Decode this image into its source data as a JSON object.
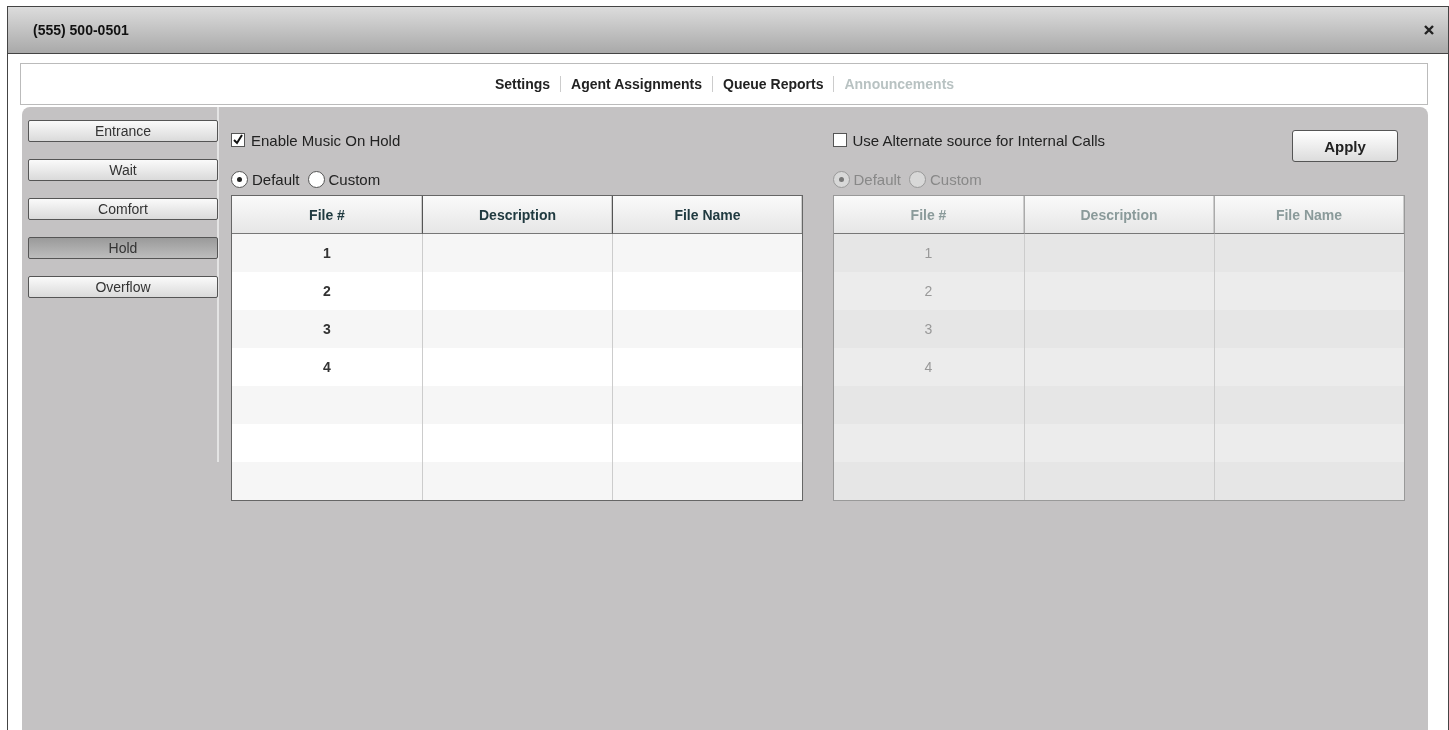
{
  "window": {
    "title": "(555) 500-0501"
  },
  "tabs": [
    {
      "label": "Settings",
      "selected": false
    },
    {
      "label": "Agent Assignments",
      "selected": false
    },
    {
      "label": "Queue Reports",
      "selected": false
    },
    {
      "label": "Announcements",
      "selected": true
    }
  ],
  "sidebar": {
    "items": [
      {
        "label": "Entrance",
        "selected": false
      },
      {
        "label": "Wait",
        "selected": false
      },
      {
        "label": "Comfort",
        "selected": false
      },
      {
        "label": "Hold",
        "selected": true
      },
      {
        "label": "Overflow",
        "selected": false
      }
    ]
  },
  "sections": [
    {
      "checkbox": {
        "label": "Enable Music On Hold",
        "checked": true
      },
      "disabled": false,
      "radios": [
        {
          "label": "Default",
          "selected": true
        },
        {
          "label": "Custom",
          "selected": false
        }
      ],
      "table": {
        "columns": [
          "File #",
          "Description",
          "File Name"
        ],
        "rows": [
          [
            "1"
          ],
          [
            "2"
          ],
          [
            "3"
          ],
          [
            "4"
          ]
        ]
      }
    },
    {
      "checkbox": {
        "label": "Use Alternate source for Internal Calls",
        "checked": false
      },
      "disabled": true,
      "radios": [
        {
          "label": "Default",
          "selected": true
        },
        {
          "label": "Custom",
          "selected": false
        }
      ],
      "table": {
        "columns": [
          "File #",
          "Description",
          "File Name"
        ],
        "rows": [
          [
            "1"
          ],
          [
            "2"
          ],
          [
            "3"
          ],
          [
            "4"
          ]
        ]
      }
    }
  ],
  "apply_button": "Apply"
}
